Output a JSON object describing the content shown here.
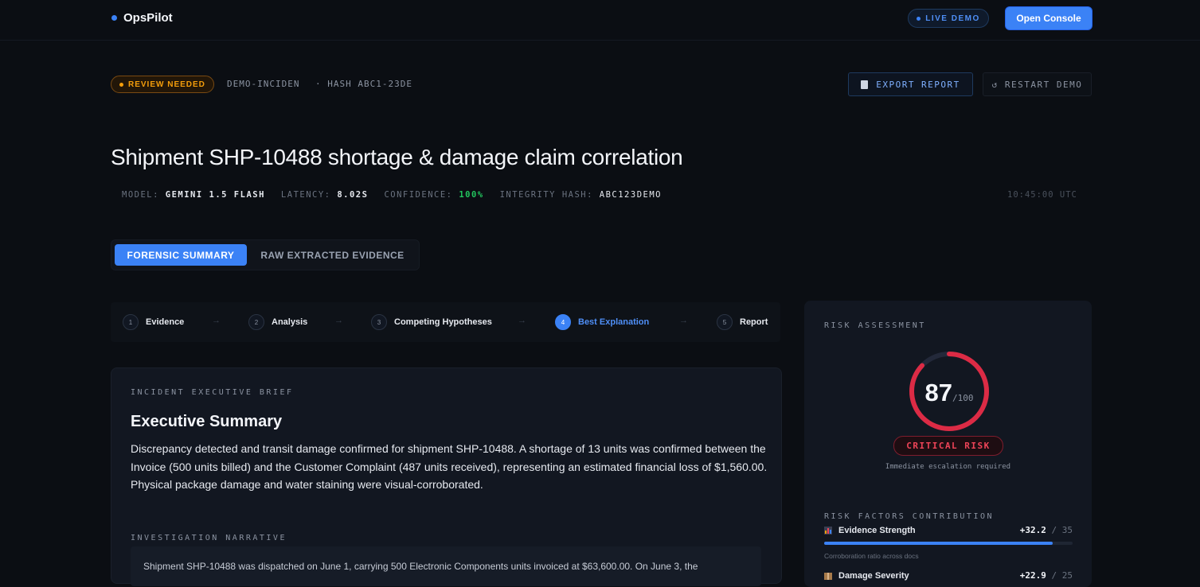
{
  "nav": {
    "brand": "OpsPilot",
    "live_label": "LIVE DEMO",
    "console_label": "Open Console"
  },
  "incident": {
    "status_badge": "REVIEW NEEDED",
    "id_label": "DEMO-INCIDEN",
    "hash_label": "· HASH ABC1-23DE",
    "export_label": "EXPORT REPORT",
    "restart_label": "↺ RESTART DEMO",
    "title": "Shipment SHP-10488 shortage & damage claim correlation"
  },
  "meta": {
    "model_key": "MODEL:",
    "model_val": "GEMINI 1.5 FLASH",
    "latency_key": "LATENCY:",
    "latency_val": "8.02S",
    "confidence_key": "CONFIDENCE:",
    "confidence_val": "100%",
    "hash_key": "INTEGRITY HASH:",
    "hash_val": "ABC123DEMO",
    "timestamp": "10:45:00 UTC"
  },
  "tabs": [
    {
      "label": "FORENSIC SUMMARY",
      "active": true
    },
    {
      "label": "RAW EXTRACTED EVIDENCE",
      "active": false
    }
  ],
  "steps": [
    {
      "num": "1",
      "label": "Evidence"
    },
    {
      "num": "2",
      "label": "Analysis"
    },
    {
      "num": "3",
      "label": "Competing Hypotheses"
    },
    {
      "num": "4",
      "label": "Best Explanation"
    },
    {
      "num": "5",
      "label": "Report"
    }
  ],
  "brief": {
    "eyebrow": "INCIDENT EXECUTIVE BRIEF",
    "title": "Executive Summary",
    "text": "Discrepancy detected and transit damage confirmed for shipment SHP-10488. A shortage of 13 units was confirmed between the Invoice (500 units billed) and the Customer Complaint (487 units received), representing an estimated financial loss of $1,560.00. Physical package damage and water staining were visual-corroborated.",
    "narrative_eyebrow": "INVESTIGATION NARRATIVE",
    "narrative_text": "Shipment SHP-10488 was dispatched on June 1, carrying 500 Electronic Components units invoiced at $63,600.00. On June 3, the"
  },
  "risk": {
    "eyebrow": "RISK ASSESSMENT",
    "score": "87",
    "max": "/100",
    "score_fraction": 0.87,
    "level": "CRITICAL RISK",
    "subtext": "Immediate escalation required",
    "factors_eyebrow": "RISK FACTORS CONTRIBUTION",
    "factors": [
      {
        "name": "Evidence Strength",
        "score": "+32.2",
        "max": "/ 35",
        "fill": 0.92,
        "sub": "Corroboration ratio across docs"
      },
      {
        "name": "Damage Severity",
        "score": "+22.9",
        "max": "/ 25",
        "fill": 0.9,
        "sub": ""
      }
    ]
  },
  "colors": {
    "accent": "#3b82f6",
    "warning": "#f59e0b",
    "critical": "#e11d48",
    "success": "#22c55e"
  }
}
